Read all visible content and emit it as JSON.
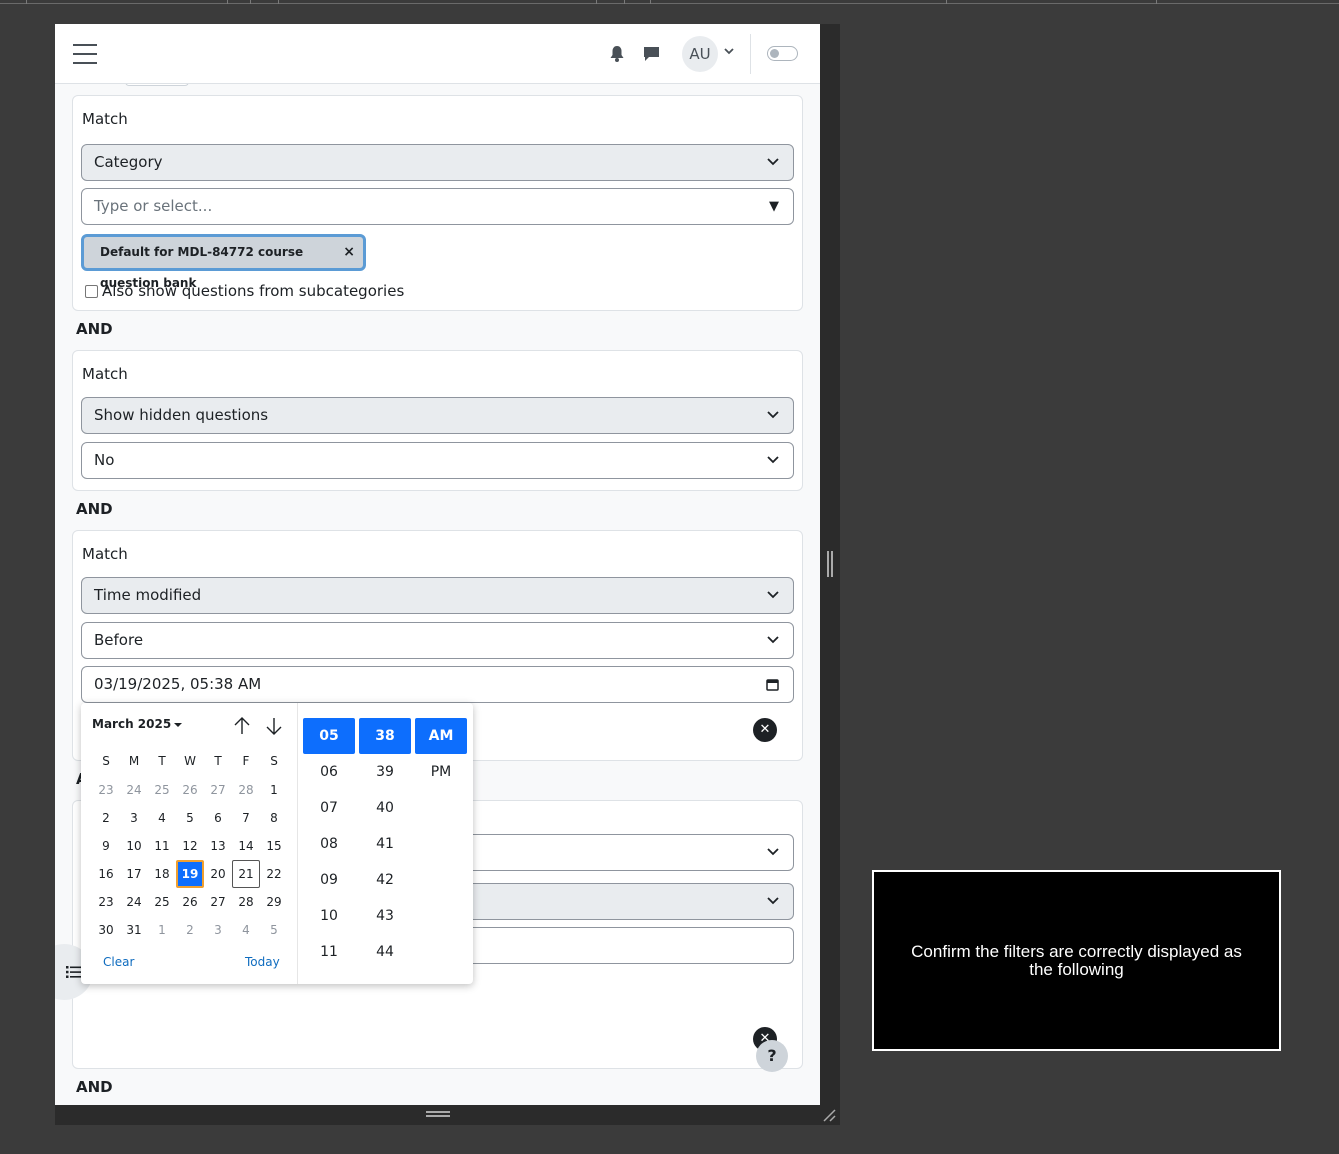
{
  "navbar": {
    "avatar_initials": "AU"
  },
  "filters": {
    "category": {
      "match_label": "Match",
      "type_value": "Category",
      "autocomplete_placeholder": "Type or select...",
      "selected_pill": "Default for MDL-84772 course question bank",
      "pill_remove": "×",
      "subcategories_label": "Also show questions from subcategories"
    },
    "and_1": "AND",
    "hidden": {
      "match_label": "Match",
      "type_value": "Show hidden questions",
      "value": "No"
    },
    "and_2": "AND",
    "time": {
      "match_label": "Match",
      "type_value": "Time modified",
      "operator": "Before",
      "datetime_value": "03/19/2025, 05:38 AM"
    },
    "and_3_partial": "A",
    "and_4": "AND",
    "remove_glyph": "✕"
  },
  "datepicker": {
    "month_label": "March 2025",
    "weekdays": [
      "S",
      "M",
      "T",
      "W",
      "T",
      "F",
      "S"
    ],
    "weeks": [
      [
        "23",
        "24",
        "25",
        "26",
        "27",
        "28",
        "1"
      ],
      [
        "2",
        "3",
        "4",
        "5",
        "6",
        "7",
        "8"
      ],
      [
        "9",
        "10",
        "11",
        "12",
        "13",
        "14",
        "15"
      ],
      [
        "16",
        "17",
        "18",
        "19",
        "20",
        "21",
        "22"
      ],
      [
        "23",
        "24",
        "25",
        "26",
        "27",
        "28",
        "29"
      ],
      [
        "30",
        "31",
        "1",
        "2",
        "3",
        "4",
        "5"
      ]
    ],
    "selected_day": "19",
    "today_day": "21",
    "clear_label": "Clear",
    "today_label": "Today",
    "hours": [
      "05",
      "06",
      "07",
      "08",
      "09",
      "10",
      "11"
    ],
    "minutes": [
      "38",
      "39",
      "40",
      "41",
      "42",
      "43",
      "44"
    ],
    "meridiem": [
      "AM",
      "PM"
    ],
    "selected_hour": "05",
    "selected_minute": "38",
    "selected_meridiem": "AM"
  },
  "help_label": "?",
  "tooltip_text": "Confirm the filters are correctly displayed as the following",
  "colors": {
    "accent": "#0d6efd",
    "link": "#0f6cbf",
    "pill_focus": "#5b9bd5",
    "backdrop": "#3b3b3b"
  }
}
